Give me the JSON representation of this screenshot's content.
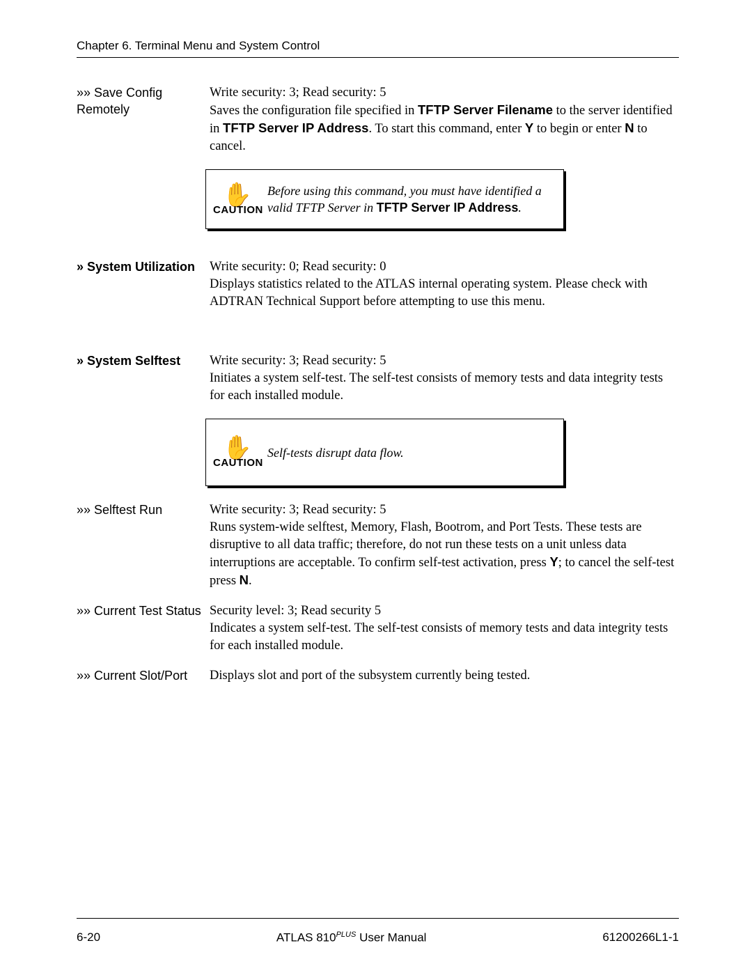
{
  "header": {
    "chapter": "Chapter 6.  Terminal Menu and System Control"
  },
  "entries": {
    "save_config": {
      "label": "»» Save Config Remotely",
      "security": "Write security: 3; Read security: 5",
      "body_pre": "Saves the configuration file specified in ",
      "bold1": "TFTP Server Filename",
      "body_mid1": " to the server identified in ",
      "bold2": "TFTP Server IP Address",
      "body_mid2": ". To start this command, enter ",
      "bold3": "Y",
      "body_mid3": " to begin or enter ",
      "bold4": "N",
      "body_end": " to cancel."
    },
    "caution1": {
      "label": "CAUTION",
      "text_pre": "Before using this command, you must have identified a valid TFTP Server in ",
      "bold": "TFTP Server IP Address",
      "text_post": "."
    },
    "system_util": {
      "label": "» System Utilization",
      "security": "Write security: 0; Read security: 0",
      "body": "Displays statistics related to the ATLAS internal operating system. Please check with ADTRAN Technical Support before attempting to use this menu."
    },
    "system_selftest": {
      "label": "» System Selftest",
      "security": "Write security: 3; Read security: 5",
      "body": "Initiates a system self-test. The self-test consists of memory tests and data integrity tests for each installed module."
    },
    "caution2": {
      "label": "CAUTION",
      "text": "Self-tests disrupt data flow."
    },
    "selftest_run": {
      "label": "»» Selftest Run",
      "security": "Write security: 3; Read security: 5",
      "body_pre": "Runs system-wide selftest, Memory, Flash, Bootrom, and Port Tests. These tests are disruptive to all data traffic; therefore, do not run these tests on a unit unless data interruptions are acceptable. To confirm self-test activation, press ",
      "bold1": "Y",
      "body_mid": "; to cancel the self-test press ",
      "bold2": "N",
      "body_end": "."
    },
    "current_test_status": {
      "label": "»» Current Test Status",
      "security": "Security level: 3; Read security 5",
      "body": "Indicates a system self-test. The self-test consists of memory tests and data integrity tests for each installed module."
    },
    "current_slot_port": {
      "label": "»» Current Slot/Port",
      "body": "Displays slot and port of the subsystem currently being tested."
    }
  },
  "footer": {
    "left": "6-20",
    "center_pre": "ATLAS 810",
    "center_sup": "PLUS",
    "center_post": " User Manual",
    "right": "61200266L1-1"
  }
}
